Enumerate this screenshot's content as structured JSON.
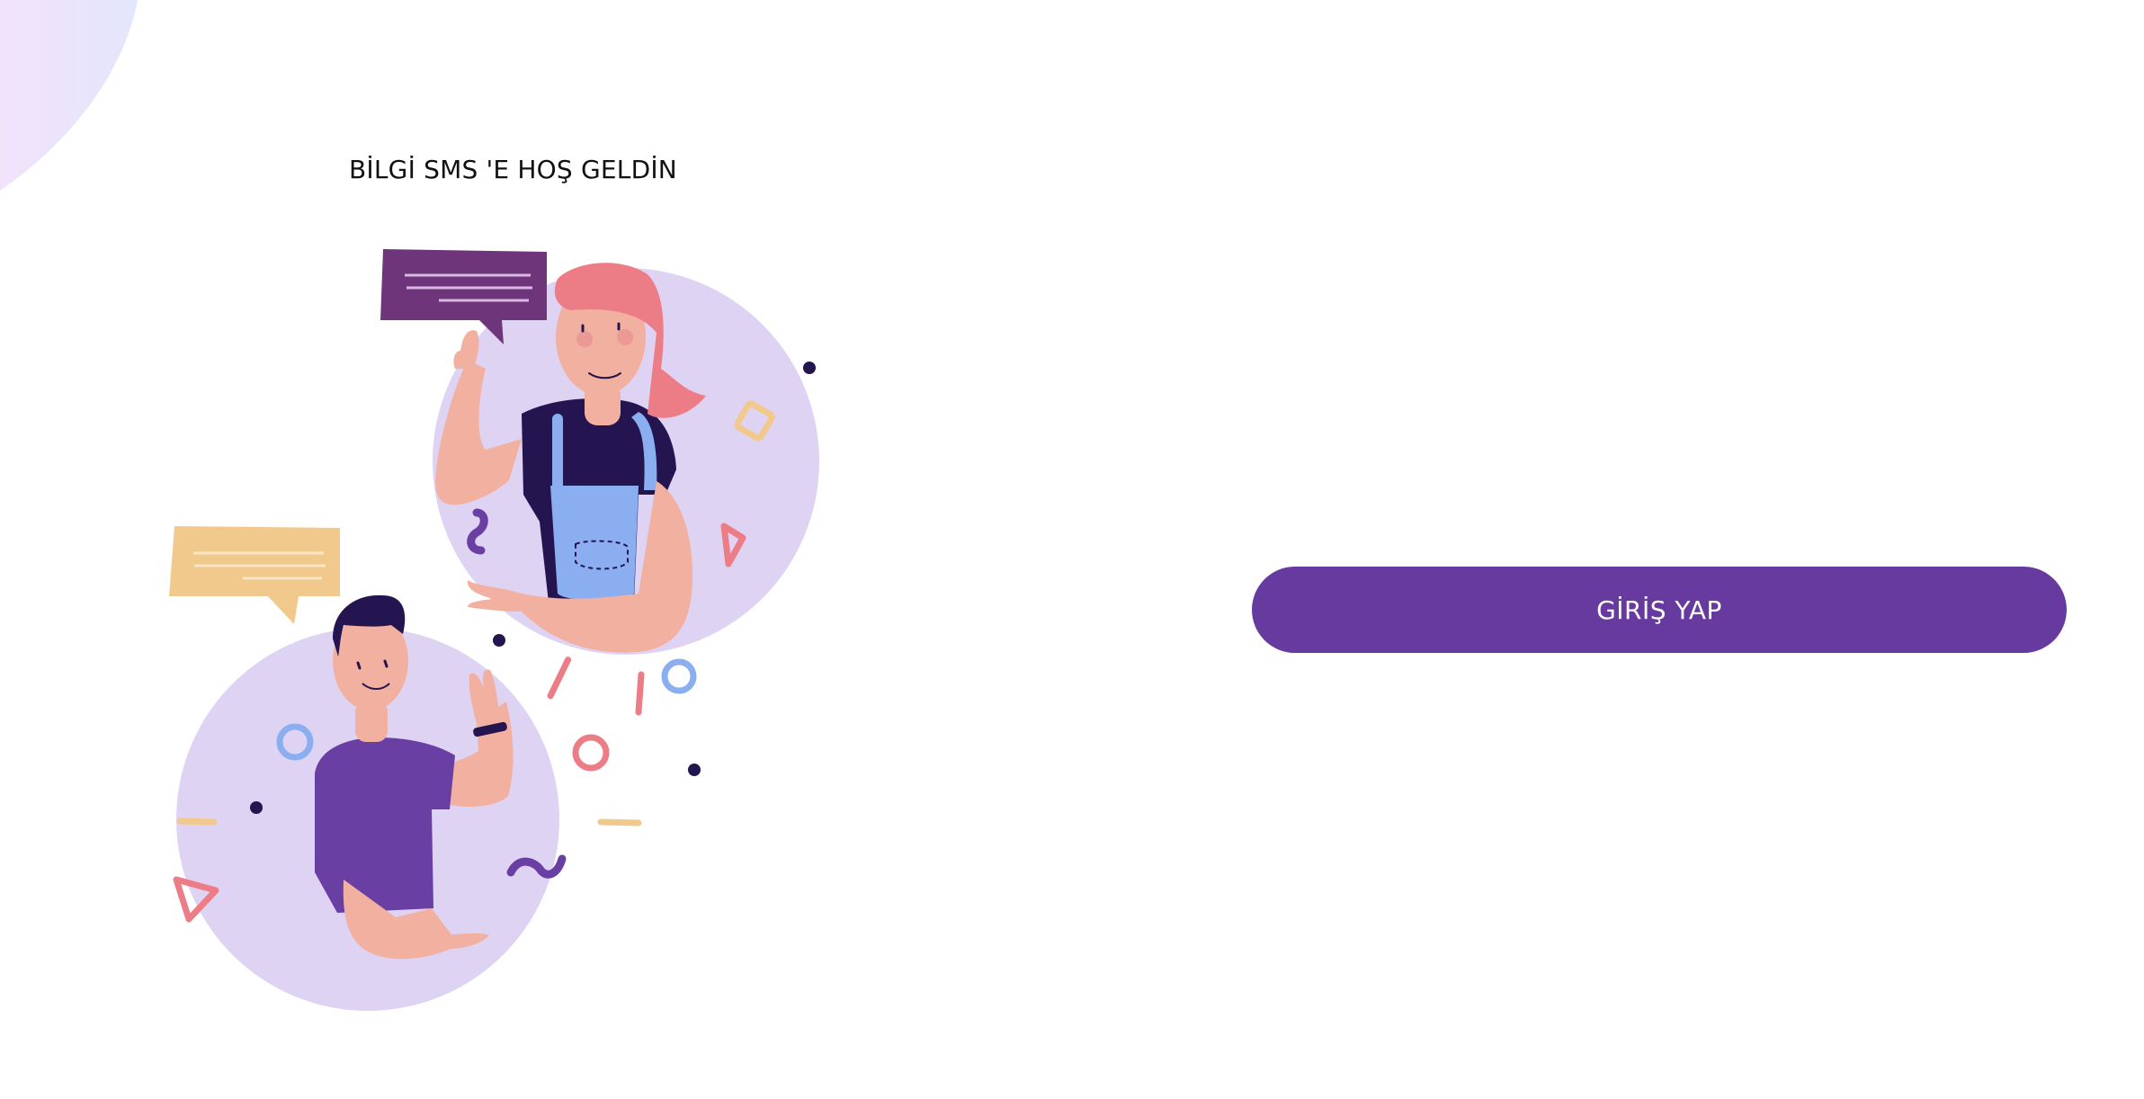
{
  "welcome": {
    "title": "BİLGİ SMS 'E HOŞ GELDİN"
  },
  "login": {
    "button_label": "GİRİŞ YAP"
  },
  "colors": {
    "accent": "#673a9f",
    "circle": "#dfd3f3",
    "dark": "#24144f",
    "skin": "#f2b0a0",
    "hair_pink": "#ec7d87",
    "bubble_purple": "#6f357a",
    "bubble_yellow": "#f2c98c",
    "overalls": "#8aaef0",
    "shirt_purple": "#6a3fa4"
  }
}
